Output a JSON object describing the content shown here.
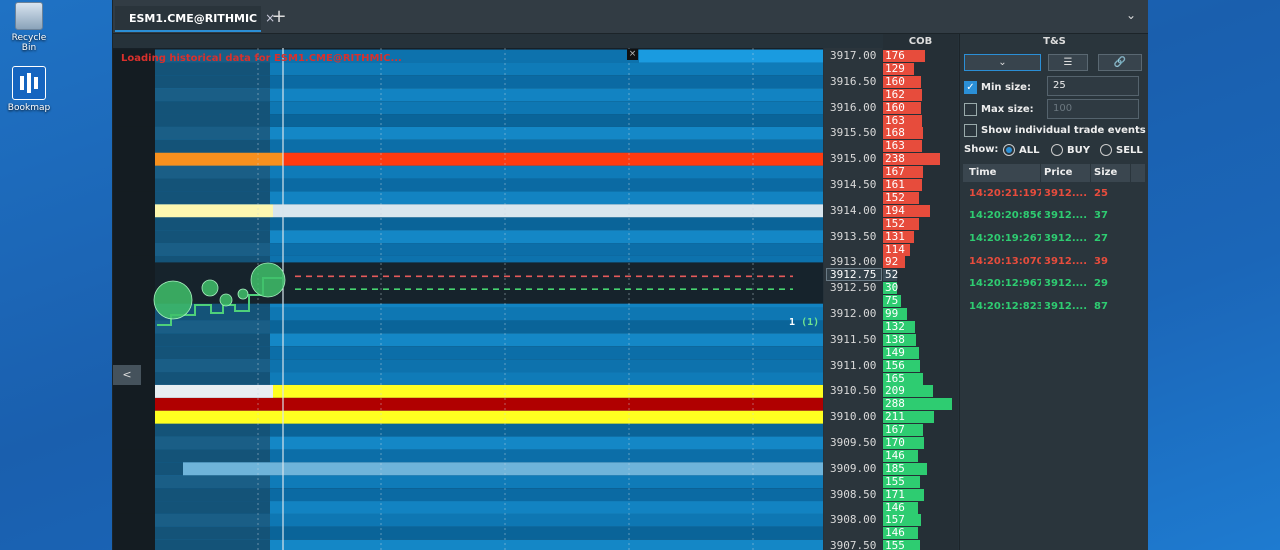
{
  "desktop": {
    "recycle_bin": "Recycle Bin",
    "bookmap": "Bookmap"
  },
  "window": {
    "tab_label": "ESM1.CME@RITHMIC",
    "tab_close": "×",
    "tab_add": "+",
    "menu_chevron": "⌄"
  },
  "heatmap": {
    "loading_message": "Loading historical data for ESM1.CME@RITHMIC...",
    "close_glyph": "×",
    "collapse_glyph": "<",
    "order_qty": "1",
    "order_pending": "(1)"
  },
  "price_axis": {
    "prices": [
      "3917.00",
      "3916.50",
      "3916.00",
      "3915.50",
      "3915.00",
      "3914.50",
      "3914.00",
      "3913.50",
      "3913.00",
      "3912.50",
      "3912.00",
      "3911.50",
      "3911.00",
      "3910.50",
      "3910.00",
      "3909.50",
      "3909.00",
      "3908.50",
      "3908.00",
      "3907.50"
    ],
    "current": "3912.75"
  },
  "cob": {
    "title": "COB",
    "ask_values": [
      176,
      129,
      160,
      162,
      160,
      163,
      168,
      163,
      238,
      167,
      161,
      152,
      194,
      152,
      131,
      114,
      92
    ],
    "current_value": 52,
    "bid_values": [
      30,
      75,
      99,
      132,
      138,
      149,
      156,
      165,
      209,
      288,
      211,
      167,
      170,
      146,
      185,
      155,
      171,
      146,
      157,
      146,
      155
    ]
  },
  "ts": {
    "title": "T&S",
    "filter_glyph": "⌄",
    "chat_glyph": "☰",
    "link_glyph": "🔗",
    "min_size_label": "Min size:",
    "min_size_value": "25",
    "max_size_label": "Max size:",
    "max_size_placeholder": "100",
    "show_individual_label": "Show individual trade events",
    "show_label": "Show:",
    "show_all": "ALL",
    "show_buy": "BUY",
    "show_sell": "SELL",
    "columns": [
      "Time",
      "Price",
      "Size"
    ],
    "rows": [
      {
        "time": "14:20:21:197",
        "price": "3912....",
        "size": "25",
        "side": "sell"
      },
      {
        "time": "14:20:20:856",
        "price": "3912....",
        "size": "37",
        "side": "buy"
      },
      {
        "time": "14:20:19:267",
        "price": "3912....",
        "size": "27",
        "side": "buy"
      },
      {
        "time": "14:20:13:070",
        "price": "3912....",
        "size": "39",
        "side": "sell"
      },
      {
        "time": "14:20:12:967",
        "price": "3912....",
        "size": "29",
        "side": "buy"
      },
      {
        "time": "14:20:12:823",
        "price": "3912....",
        "size": "87",
        "side": "buy"
      }
    ]
  },
  "colors": {
    "ask": "#e74c3c",
    "bid": "#2ecc71",
    "accent": "#2b8fd6",
    "liquidity_high": "#ff3a10",
    "liquidity_med": "#ffff20",
    "liquidity_max": "#b00000"
  }
}
